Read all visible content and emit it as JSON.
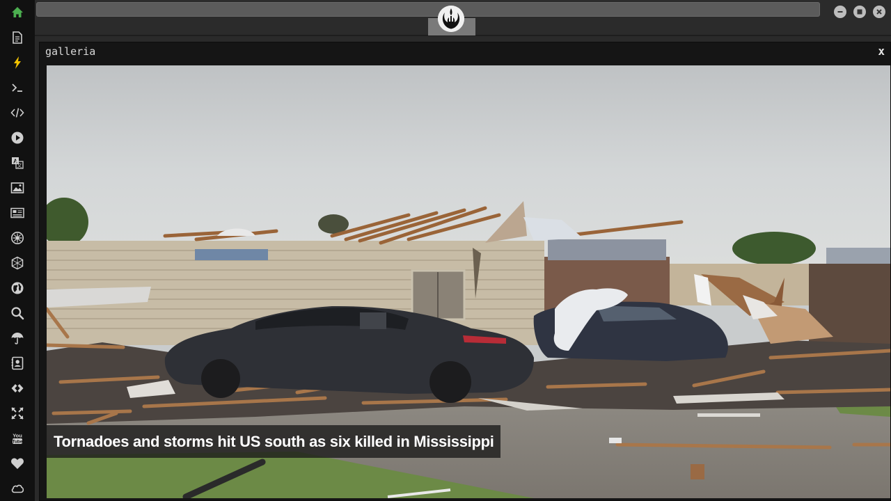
{
  "sidebar": {
    "items": [
      {
        "name": "home-icon",
        "color": "#4caf50"
      },
      {
        "name": "document-icon",
        "color": "#cfcfcf"
      },
      {
        "name": "lightning-icon",
        "color": "#f2c200"
      },
      {
        "name": "terminal-icon",
        "color": "#cfcfcf"
      },
      {
        "name": "code-icon",
        "color": "#cfcfcf"
      },
      {
        "name": "play-icon",
        "color": "#cfcfcf"
      },
      {
        "name": "translate-icon",
        "color": "#cfcfcf"
      },
      {
        "name": "image-icon",
        "color": "#cfcfcf"
      },
      {
        "name": "newspaper-icon",
        "color": "#cfcfcf"
      },
      {
        "name": "rebel-icon",
        "color": "#cfcfcf"
      },
      {
        "name": "empire-icon",
        "color": "#cfcfcf"
      },
      {
        "name": "globe-icon",
        "color": "#cfcfcf"
      },
      {
        "name": "search-icon",
        "color": "#cfcfcf"
      },
      {
        "name": "umbrella-icon",
        "color": "#cfcfcf"
      },
      {
        "name": "contact-icon",
        "color": "#cfcfcf"
      },
      {
        "name": "api-icon",
        "color": "#cfcfcf"
      },
      {
        "name": "expand-icon",
        "color": "#cfcfcf"
      },
      {
        "name": "youtube-icon",
        "color": "#cfcfcf",
        "label": "You Tube"
      },
      {
        "name": "heart-icon",
        "color": "#cfcfcf"
      },
      {
        "name": "cloud-icon",
        "color": "#cfcfcf"
      }
    ]
  },
  "topbar": {
    "emblem": "rebel-alliance-icon"
  },
  "window": {
    "title": "galleria",
    "close_label": "x"
  },
  "gallery": {
    "caption": "Tornadoes and storms hit US south as six killed in Mississippi"
  },
  "colors": {
    "accent_green": "#4caf50",
    "accent_yellow": "#f2c200",
    "sidebar_bg": "#111111"
  }
}
